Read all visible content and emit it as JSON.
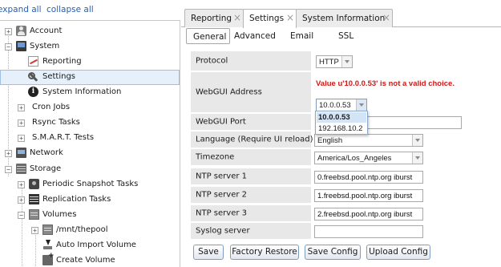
{
  "tree_controls": {
    "expand_all": "expand all",
    "collapse_all": "collapse all"
  },
  "tree": {
    "account": "Account",
    "system": "System",
    "reporting": "Reporting",
    "settings": "Settings",
    "system_information": "System Information",
    "cron_jobs": "Cron Jobs",
    "rsync_tasks": "Rsync Tasks",
    "smart_tests": "S.M.A.R.T. Tests",
    "network": "Network",
    "storage": "Storage",
    "periodic_snapshot_tasks": "Periodic Snapshot Tasks",
    "replication_tasks": "Replication Tasks",
    "volumes": "Volumes",
    "mnt_thepool": "/mnt/thepool",
    "auto_import_volume": "Auto Import Volume",
    "create_volume": "Create Volume"
  },
  "tabs": {
    "reporting": "Reporting",
    "settings": "Settings",
    "system_information": "System Information"
  },
  "subtabs": {
    "general": "General",
    "advanced": "Advanced",
    "email": "Email",
    "ssl": "SSL"
  },
  "form": {
    "protocol_label": "Protocol",
    "protocol_value": "HTTP",
    "webgui_address_label": "WebGUI Address",
    "webgui_address_error": "Value u'10.0.0.53' is not a valid choice.",
    "webgui_address_value": "10.0.0.53",
    "webgui_address_options": [
      "10.0.0.53",
      "192.168.10.2"
    ],
    "webgui_port_label": "WebGUI Port",
    "webgui_port_value": "",
    "language_label": "Language (Require UI reload)",
    "language_value": "English",
    "timezone_label": "Timezone",
    "timezone_value": "America/Los_Angeles",
    "ntp1_label": "NTP server 1",
    "ntp1_value": "0.freebsd.pool.ntp.org iburst",
    "ntp2_label": "NTP server 2",
    "ntp2_value": "1.freebsd.pool.ntp.org iburst",
    "ntp3_label": "NTP server 3",
    "ntp3_value": "2.freebsd.pool.ntp.org iburst",
    "syslog_label": "Syslog server",
    "syslog_value": ""
  },
  "buttons": {
    "save": "Save",
    "factory_restore": "Factory Restore",
    "save_config": "Save Config",
    "upload_config": "Upload Config"
  },
  "colors": {
    "error": "#d01818",
    "link": "#2a5db0",
    "selected_row": "#e6f0fb"
  }
}
